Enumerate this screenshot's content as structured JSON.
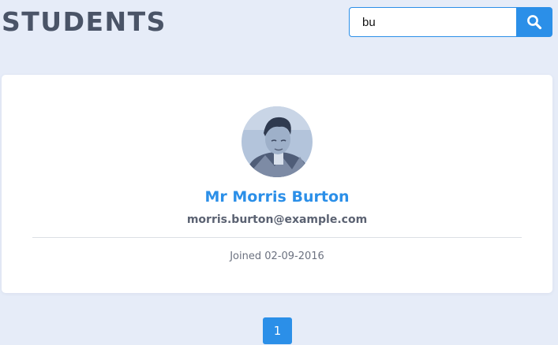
{
  "header": {
    "title": "STUDENTS"
  },
  "search": {
    "value": "bu",
    "icon": "search-icon"
  },
  "student": {
    "name": "Mr Morris Burton",
    "email": "morris.burton@example.com",
    "joined": "Joined 02-09-2016",
    "avatar_icon": "avatar-photo"
  },
  "pagination": {
    "current_page": "1"
  },
  "colors": {
    "accent": "#2b8fe8",
    "background": "#e6ecf8",
    "title": "#4a5467"
  }
}
